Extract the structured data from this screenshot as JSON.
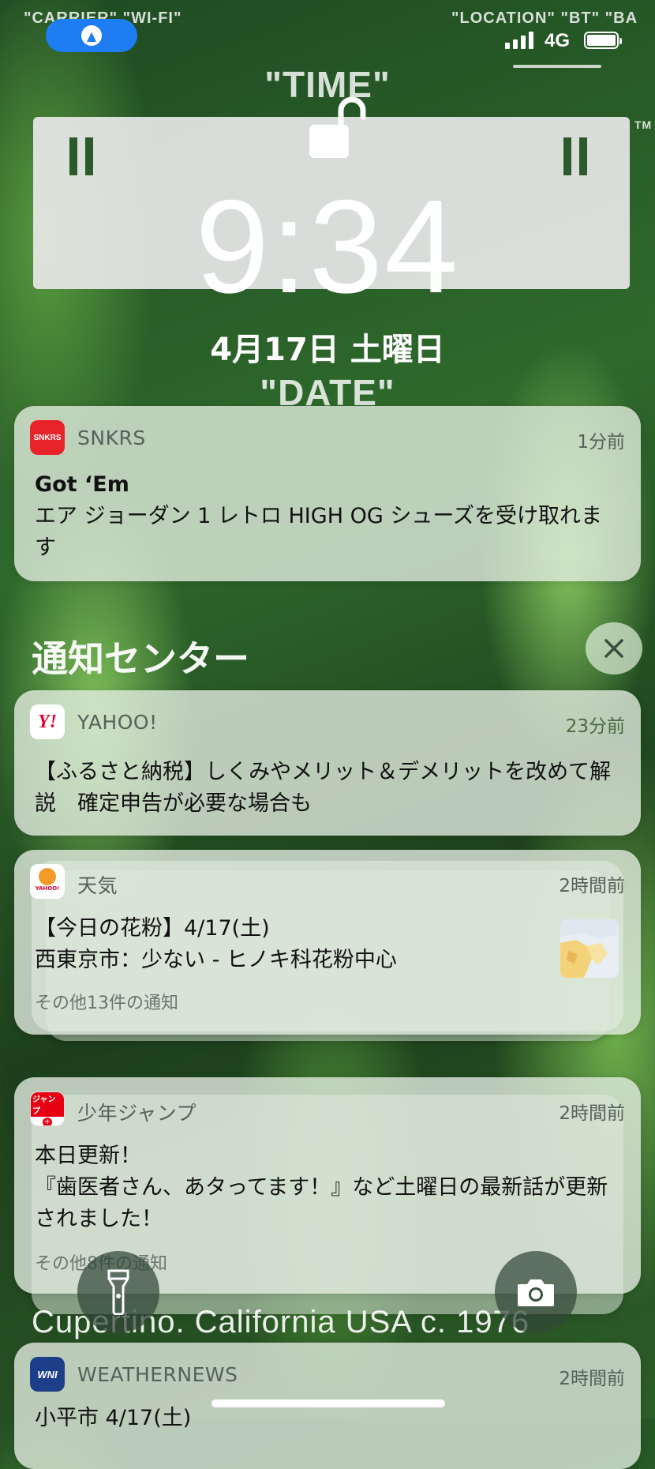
{
  "overlay": {
    "carrier": "\"CARRIER\"",
    "wifi": "\"WI-FI\"",
    "location": "\"LOCATION\"",
    "bt": "\"BT\"",
    "ba": "\"BA",
    "time_label": "\"TIME\"",
    "date_label": "\"DATE\"",
    "tm": "TM",
    "bottom_text": "Cupertino. California USA  c. 1976"
  },
  "status_bar": {
    "network": "4G",
    "signal_bars": 4,
    "battery_level": 1.0
  },
  "lock_screen": {
    "time": "9:34",
    "date": "4月17日 土曜日"
  },
  "notification_center": {
    "title": "通知センター"
  },
  "notifications": [
    {
      "app": "SNKRS",
      "time": "1分前",
      "title": "Got ‘Em",
      "body": " エア ジョーダン 1 レトロ HIGH OG シューズを受け取れます"
    },
    {
      "app": "YAHOO!",
      "time": "23分前",
      "body": "【ふるさと納税】しくみやメリット＆デメリットを改めて解説　確定申告が必要な場合も"
    },
    {
      "app": "天気",
      "time": "2時間前",
      "line1": "【今日の花粉】4/17(土)",
      "line2": "西東京市：少ない - ヒノキ科花粉中心",
      "more": "その他13件の通知"
    },
    {
      "app": "少年ジャンプ",
      "time": "2時間前",
      "title": "本日更新！",
      "body": "『歯医者さん、あタってます！』など土曜日の最新話が更新されました！",
      "more": "その他8件の通知"
    },
    {
      "app": "WEATHERNEWS",
      "time": "2時間前",
      "body": "小平市 4/17(土)"
    }
  ],
  "icons": {
    "flashlight": "flashlight-icon",
    "camera": "camera-icon",
    "lock": "unlocked-padlock-icon"
  }
}
